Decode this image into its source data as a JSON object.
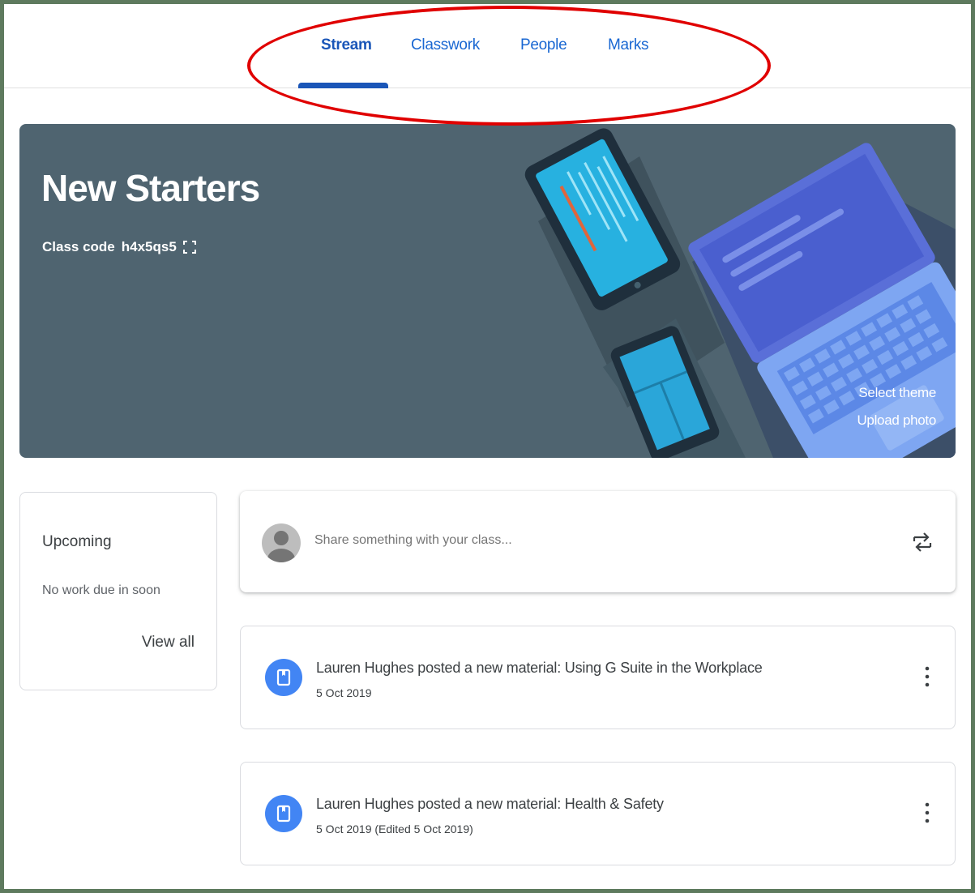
{
  "tabs": [
    {
      "label": "Stream",
      "active": true
    },
    {
      "label": "Classwork",
      "active": false
    },
    {
      "label": "People",
      "active": false
    },
    {
      "label": "Marks",
      "active": false
    }
  ],
  "banner": {
    "title": "New Starters",
    "class_code_label": "Class code",
    "class_code": "h4x5qs5",
    "select_theme": "Select theme",
    "upload_photo": "Upload photo",
    "background_color": "#4f6470"
  },
  "upcoming": {
    "title": "Upcoming",
    "empty_text": "No work due in soon",
    "view_all": "View all"
  },
  "share": {
    "placeholder": "Share something with your class..."
  },
  "posts": [
    {
      "title": "Lauren Hughes posted a new material: Using G Suite in the Workplace",
      "date": "5 Oct 2019",
      "icon": "material-icon"
    },
    {
      "title": "Lauren Hughes posted a new material: Health & Safety",
      "date": "5 Oct 2019 (Edited 5 Oct 2019)",
      "icon": "material-icon"
    }
  ],
  "colors": {
    "accent": "#1a56b8",
    "post_icon": "#4285f4",
    "annotation": "#e00000"
  }
}
